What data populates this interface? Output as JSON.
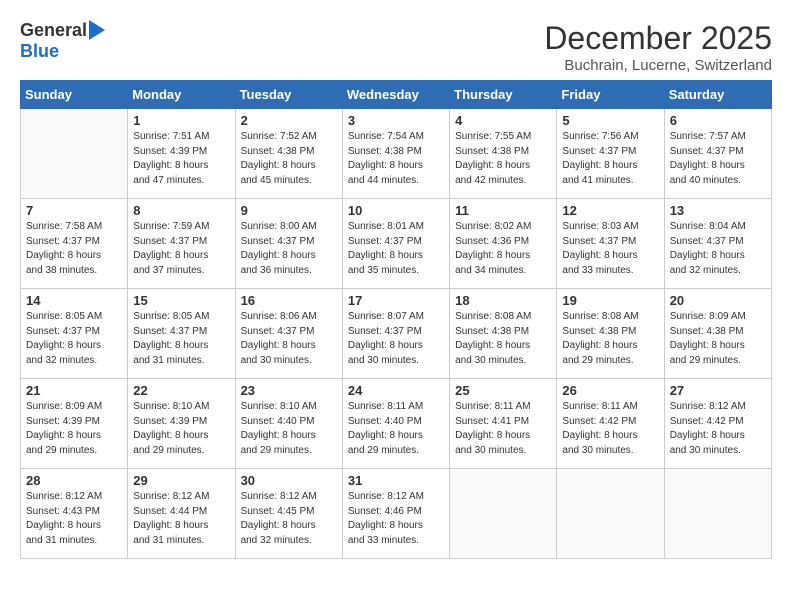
{
  "header": {
    "logo_general": "General",
    "logo_blue": "Blue",
    "month_title": "December 2025",
    "location": "Buchrain, Lucerne, Switzerland"
  },
  "days_of_week": [
    "Sunday",
    "Monday",
    "Tuesday",
    "Wednesday",
    "Thursday",
    "Friday",
    "Saturday"
  ],
  "weeks": [
    [
      {
        "day": "",
        "info": ""
      },
      {
        "day": "1",
        "info": "Sunrise: 7:51 AM\nSunset: 4:39 PM\nDaylight: 8 hours\nand 47 minutes."
      },
      {
        "day": "2",
        "info": "Sunrise: 7:52 AM\nSunset: 4:38 PM\nDaylight: 8 hours\nand 45 minutes."
      },
      {
        "day": "3",
        "info": "Sunrise: 7:54 AM\nSunset: 4:38 PM\nDaylight: 8 hours\nand 44 minutes."
      },
      {
        "day": "4",
        "info": "Sunrise: 7:55 AM\nSunset: 4:38 PM\nDaylight: 8 hours\nand 42 minutes."
      },
      {
        "day": "5",
        "info": "Sunrise: 7:56 AM\nSunset: 4:37 PM\nDaylight: 8 hours\nand 41 minutes."
      },
      {
        "day": "6",
        "info": "Sunrise: 7:57 AM\nSunset: 4:37 PM\nDaylight: 8 hours\nand 40 minutes."
      }
    ],
    [
      {
        "day": "7",
        "info": "Sunrise: 7:58 AM\nSunset: 4:37 PM\nDaylight: 8 hours\nand 38 minutes."
      },
      {
        "day": "8",
        "info": "Sunrise: 7:59 AM\nSunset: 4:37 PM\nDaylight: 8 hours\nand 37 minutes."
      },
      {
        "day": "9",
        "info": "Sunrise: 8:00 AM\nSunset: 4:37 PM\nDaylight: 8 hours\nand 36 minutes."
      },
      {
        "day": "10",
        "info": "Sunrise: 8:01 AM\nSunset: 4:37 PM\nDaylight: 8 hours\nand 35 minutes."
      },
      {
        "day": "11",
        "info": "Sunrise: 8:02 AM\nSunset: 4:36 PM\nDaylight: 8 hours\nand 34 minutes."
      },
      {
        "day": "12",
        "info": "Sunrise: 8:03 AM\nSunset: 4:37 PM\nDaylight: 8 hours\nand 33 minutes."
      },
      {
        "day": "13",
        "info": "Sunrise: 8:04 AM\nSunset: 4:37 PM\nDaylight: 8 hours\nand 32 minutes."
      }
    ],
    [
      {
        "day": "14",
        "info": "Sunrise: 8:05 AM\nSunset: 4:37 PM\nDaylight: 8 hours\nand 32 minutes."
      },
      {
        "day": "15",
        "info": "Sunrise: 8:05 AM\nSunset: 4:37 PM\nDaylight: 8 hours\nand 31 minutes."
      },
      {
        "day": "16",
        "info": "Sunrise: 8:06 AM\nSunset: 4:37 PM\nDaylight: 8 hours\nand 30 minutes."
      },
      {
        "day": "17",
        "info": "Sunrise: 8:07 AM\nSunset: 4:37 PM\nDaylight: 8 hours\nand 30 minutes."
      },
      {
        "day": "18",
        "info": "Sunrise: 8:08 AM\nSunset: 4:38 PM\nDaylight: 8 hours\nand 30 minutes."
      },
      {
        "day": "19",
        "info": "Sunrise: 8:08 AM\nSunset: 4:38 PM\nDaylight: 8 hours\nand 29 minutes."
      },
      {
        "day": "20",
        "info": "Sunrise: 8:09 AM\nSunset: 4:38 PM\nDaylight: 8 hours\nand 29 minutes."
      }
    ],
    [
      {
        "day": "21",
        "info": "Sunrise: 8:09 AM\nSunset: 4:39 PM\nDaylight: 8 hours\nand 29 minutes."
      },
      {
        "day": "22",
        "info": "Sunrise: 8:10 AM\nSunset: 4:39 PM\nDaylight: 8 hours\nand 29 minutes."
      },
      {
        "day": "23",
        "info": "Sunrise: 8:10 AM\nSunset: 4:40 PM\nDaylight: 8 hours\nand 29 minutes."
      },
      {
        "day": "24",
        "info": "Sunrise: 8:11 AM\nSunset: 4:40 PM\nDaylight: 8 hours\nand 29 minutes."
      },
      {
        "day": "25",
        "info": "Sunrise: 8:11 AM\nSunset: 4:41 PM\nDaylight: 8 hours\nand 30 minutes."
      },
      {
        "day": "26",
        "info": "Sunrise: 8:11 AM\nSunset: 4:42 PM\nDaylight: 8 hours\nand 30 minutes."
      },
      {
        "day": "27",
        "info": "Sunrise: 8:12 AM\nSunset: 4:42 PM\nDaylight: 8 hours\nand 30 minutes."
      }
    ],
    [
      {
        "day": "28",
        "info": "Sunrise: 8:12 AM\nSunset: 4:43 PM\nDaylight: 8 hours\nand 31 minutes."
      },
      {
        "day": "29",
        "info": "Sunrise: 8:12 AM\nSunset: 4:44 PM\nDaylight: 8 hours\nand 31 minutes."
      },
      {
        "day": "30",
        "info": "Sunrise: 8:12 AM\nSunset: 4:45 PM\nDaylight: 8 hours\nand 32 minutes."
      },
      {
        "day": "31",
        "info": "Sunrise: 8:12 AM\nSunset: 4:46 PM\nDaylight: 8 hours\nand 33 minutes."
      },
      {
        "day": "",
        "info": ""
      },
      {
        "day": "",
        "info": ""
      },
      {
        "day": "",
        "info": ""
      }
    ]
  ]
}
